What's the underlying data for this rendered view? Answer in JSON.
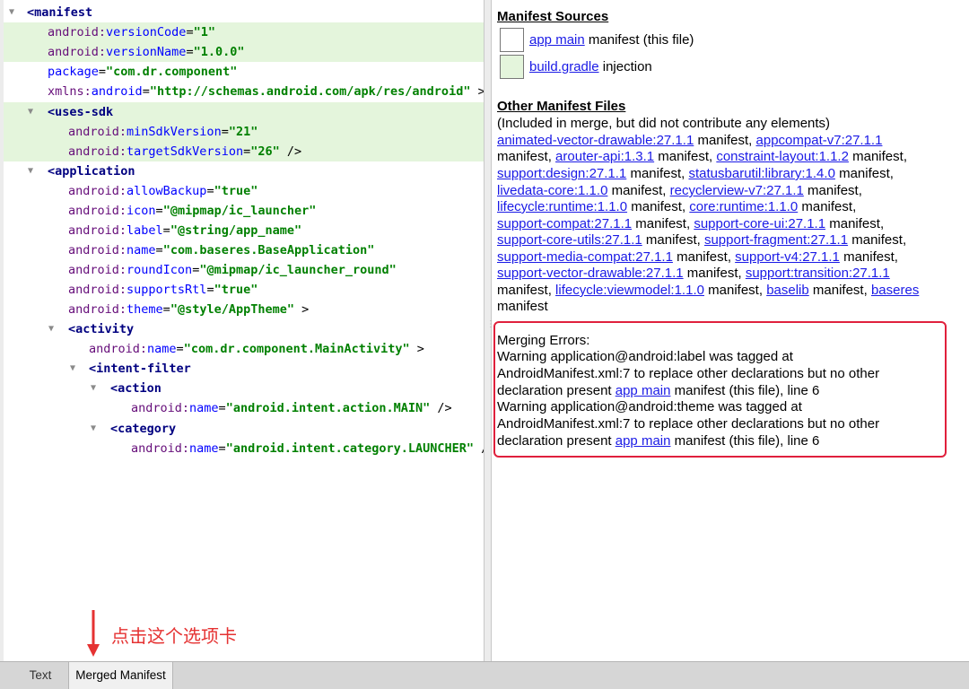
{
  "xml": {
    "lines": [
      {
        "tag": "<manifest"
      },
      {
        "ns": "android:",
        "attr": "versionCode",
        "value": "\"1\"",
        "end": ""
      },
      {
        "ns": "android:",
        "attr": "versionName",
        "value": "\"1.0.0\"",
        "end": ""
      },
      {
        "ns": "",
        "attr": "package",
        "value": "\"com.dr.component\"",
        "end": ""
      },
      {
        "ns": "xmlns:",
        "attr": "android",
        "value": "\"http://schemas.android.com/apk/res/android\"",
        "end": " >"
      },
      {
        "tag": "<uses-sdk"
      },
      {
        "ns": "android:",
        "attr": "minSdkVersion",
        "value": "\"21\"",
        "end": ""
      },
      {
        "ns": "android:",
        "attr": "targetSdkVersion",
        "value": "\"26\"",
        "end": " />"
      },
      {
        "tag": "<application"
      },
      {
        "ns": "android:",
        "attr": "allowBackup",
        "value": "\"true\"",
        "end": ""
      },
      {
        "ns": "android:",
        "attr": "icon",
        "value": "\"@mipmap/ic_launcher\"",
        "end": ""
      },
      {
        "ns": "android:",
        "attr": "label",
        "value": "\"@string/app_name\"",
        "end": ""
      },
      {
        "ns": "android:",
        "attr": "name",
        "value": "\"com.baseres.BaseApplication\"",
        "end": ""
      },
      {
        "ns": "android:",
        "attr": "roundIcon",
        "value": "\"@mipmap/ic_launcher_round\"",
        "end": ""
      },
      {
        "ns": "android:",
        "attr": "supportsRtl",
        "value": "\"true\"",
        "end": ""
      },
      {
        "ns": "android:",
        "attr": "theme",
        "value": "\"@style/AppTheme\"",
        "end": " >"
      },
      {
        "tag": "<activity"
      },
      {
        "ns": "android:",
        "attr": "name",
        "value": "\"com.dr.component.MainActivity\"",
        "end": " >"
      },
      {
        "tag": "<intent-filter"
      },
      {
        "tag": "<action"
      },
      {
        "ns": "android:",
        "attr": "name",
        "value": "\"android.intent.action.MAIN\"",
        "end": " />"
      },
      {
        "tag": "<category"
      },
      {
        "ns": "android:",
        "attr": "name",
        "value": "\"android.intent.category.LAUNCHER\"",
        "end": " /"
      }
    ]
  },
  "manifest_sources": {
    "heading": "Manifest Sources",
    "items": [
      {
        "link": "app main",
        "text": " manifest (this file)",
        "color": "#ffffff"
      },
      {
        "link": "build.gradle",
        "text": " injection",
        "color": "#e4f5dc"
      }
    ]
  },
  "other_files": {
    "heading": "Other Manifest Files",
    "subheading": "(Included in merge, but did not contribute any elements)",
    "entries": [
      "animated-vector-drawable:27.1.1",
      "appcompat-v7:27.1.1",
      "arouter-api:1.3.1",
      "constraint-layout:1.1.2",
      "support:design:27.1.1",
      "statusbarutil:library:1.4.0",
      "livedata-core:1.1.0",
      "recyclerview-v7:27.1.1",
      "lifecycle:runtime:1.1.0",
      "core:runtime:1.1.0",
      "support-compat:27.1.1",
      "support-core-ui:27.1.1",
      "support-core-utils:27.1.1",
      "support-fragment:27.1.1",
      "support-media-compat:27.1.1",
      "support-v4:27.1.1",
      "support-vector-drawable:27.1.1",
      "support:transition:27.1.1",
      "lifecycle:viewmodel:1.1.0",
      "baselib",
      "baseres"
    ],
    "manifest_word": "manifest"
  },
  "errors": {
    "title": "Merging Errors:",
    "warn1_a": "Warning application@android:label was tagged at",
    "warn2_a": "Warning application@android:theme was tagged at",
    "warn_b": "AndroidManifest.xml:7 to replace other declarations but no other",
    "warn_c_pre": "declaration present ",
    "warn_c_link": "app main",
    "warn_c_post": " manifest (this file), line 6",
    "box_color": "#e0203c"
  },
  "annotation": {
    "text": "点击这个选项卡"
  },
  "tabs": {
    "text": "Text",
    "merged": "Merged Manifest"
  }
}
